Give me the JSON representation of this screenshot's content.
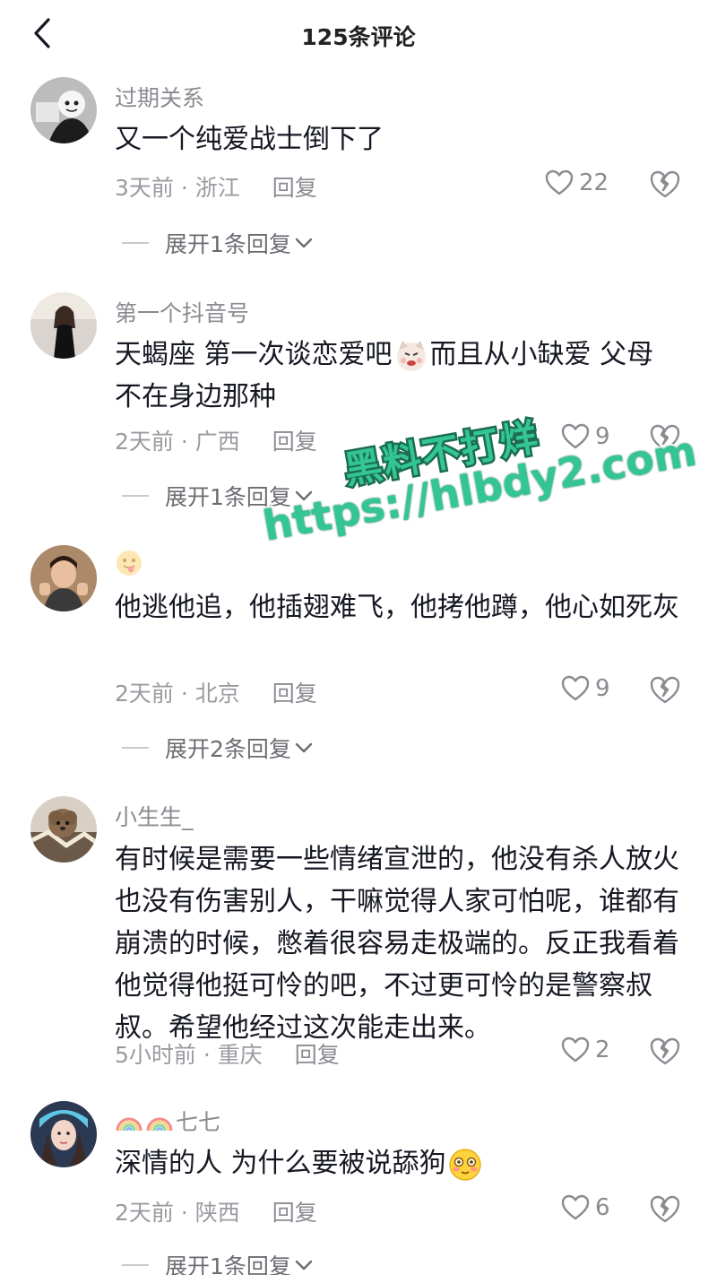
{
  "header": {
    "title": "125条评论",
    "back_icon": "chevron-left-icon"
  },
  "comments": [
    {
      "username": "过期关系",
      "content": "又一个纯爱战士倒下了",
      "time": "3天前",
      "location": "浙江",
      "reply_label": "回复",
      "likes": "22",
      "expand_label": "展开1条回复"
    },
    {
      "username": "第一个抖音号",
      "content_a": "天蝎座 第一次谈恋爱吧",
      "content_emoji": "cat-emoji",
      "content_b": "而且从小缺爱 父母不在身边那种",
      "time": "2天前",
      "location": "广西",
      "reply_label": "回复",
      "likes": "9",
      "expand_label": "展开1条回复"
    },
    {
      "username_emoji": "tongue-face-emoji",
      "content": "他逃他追，他插翅难飞，他拷他蹲，他心如死灰",
      "time": "2天前",
      "location": "北京",
      "reply_label": "回复",
      "likes": "9",
      "expand_label": "展开2条回复"
    },
    {
      "username": "小生生_",
      "content": "有时候是需要一些情绪宣泄的，他没有杀人放火也没有伤害别人，干嘛觉得人家可怕呢，谁都有崩溃的时候，憋着很容易走极端的。反正我看着他觉得他挺可怜的吧，不过更可怜的是警察叔叔。希望他经过这次能走出来。",
      "time": "5小时前",
      "location": "重庆",
      "reply_label": "回复",
      "likes": "2"
    },
    {
      "username_emoji": "rainbow-emoji",
      "username": "七七",
      "content": "深情的人 为什么要被说舔狗",
      "content_emoji": "blushing-face-emoji",
      "time": "2天前",
      "location": "陕西",
      "reply_label": "回复",
      "likes": "6",
      "expand_label": "展开1条回复"
    }
  ],
  "watermark": {
    "line1": "黑料不打烊",
    "line2": "https://hlbdy2.com"
  },
  "colors": {
    "text": "#161823",
    "secondary": "#8a8b91",
    "watermark_green": "#34c596"
  }
}
